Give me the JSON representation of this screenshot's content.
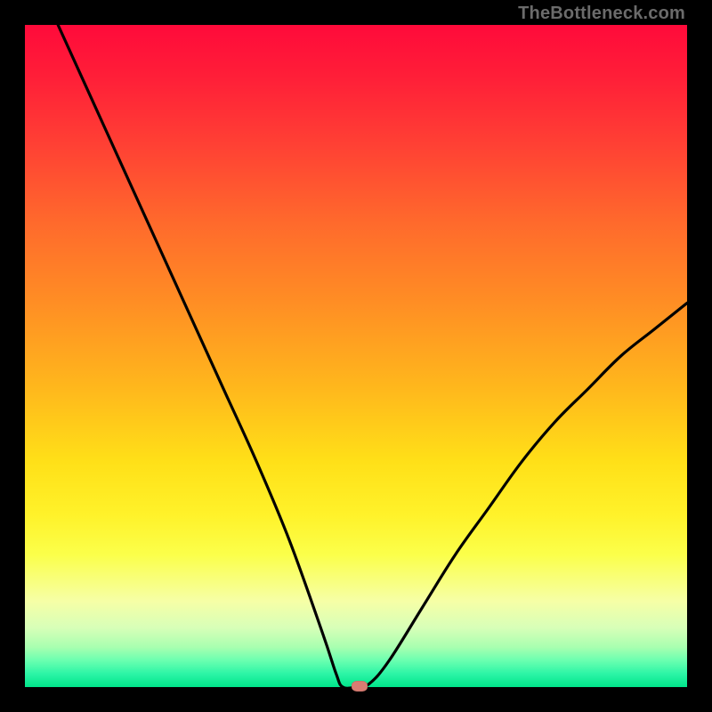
{
  "watermark": "TheBottleneck.com",
  "chart_data": {
    "type": "line",
    "title": "",
    "xlabel": "",
    "ylabel": "",
    "xlim": [
      0,
      100
    ],
    "ylim": [
      0,
      100
    ],
    "grid": false,
    "legend": false,
    "background_gradient": [
      {
        "pos": 0.0,
        "color": "#ff0a3a"
      },
      {
        "pos": 0.18,
        "color": "#ff4034"
      },
      {
        "pos": 0.42,
        "color": "#ff8e24"
      },
      {
        "pos": 0.66,
        "color": "#ffe018"
      },
      {
        "pos": 0.8,
        "color": "#fbff4a"
      },
      {
        "pos": 0.94,
        "color": "#a8ffb0"
      },
      {
        "pos": 1.0,
        "color": "#00e58a"
      }
    ],
    "series": [
      {
        "name": "bottleneck-curve",
        "color": "#000000",
        "x": [
          5,
          10,
          15,
          20,
          25,
          30,
          35,
          40,
          45,
          47,
          48,
          50,
          52,
          55,
          60,
          65,
          70,
          75,
          80,
          85,
          90,
          95,
          100
        ],
        "y": [
          100,
          89,
          78,
          67,
          56,
          45,
          34,
          22,
          8,
          2,
          0,
          0,
          0.5,
          4,
          12,
          20,
          27,
          34,
          40,
          45,
          50,
          54,
          58
        ]
      }
    ],
    "marker": {
      "x": 50.5,
      "y": 0,
      "color": "#d97c72"
    }
  }
}
